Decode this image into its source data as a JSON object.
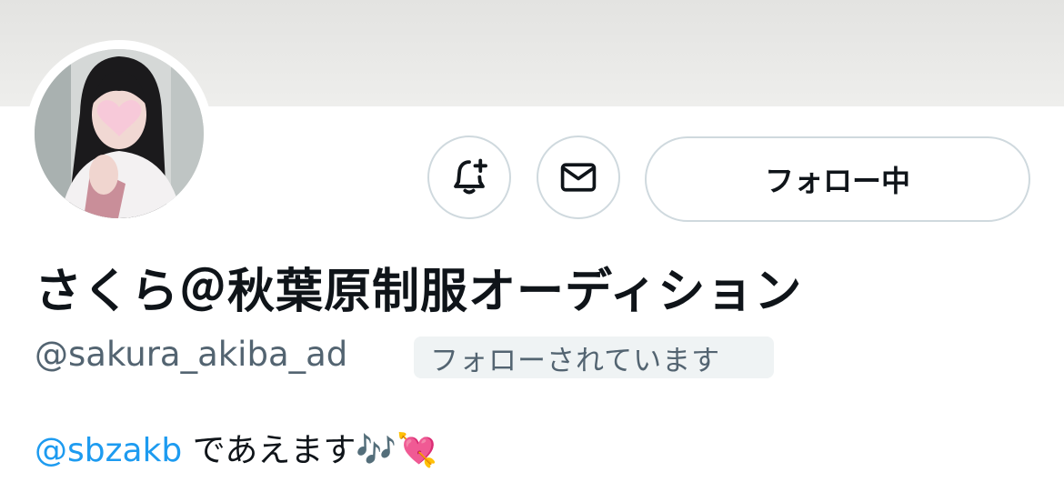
{
  "profile": {
    "display_name": "さくら＠秋葉原制服オーディション",
    "handle": "@sakura_akiba_ad",
    "follows_you": "フォローされています",
    "follow_button": "フォロー中",
    "bio": {
      "mention": "@sbzakb",
      "text": " であえます",
      "emoji": "🎶💘"
    }
  },
  "icons": {
    "notify": "bell-plus-icon",
    "message": "envelope-icon",
    "avatar": "avatar"
  },
  "colors": {
    "accent": "#1d9bf0",
    "text": "#0f1419",
    "secondary": "#536471",
    "border": "#cfd9de",
    "badge_bg": "#eff3f4",
    "banner": "#e6e6e4"
  }
}
